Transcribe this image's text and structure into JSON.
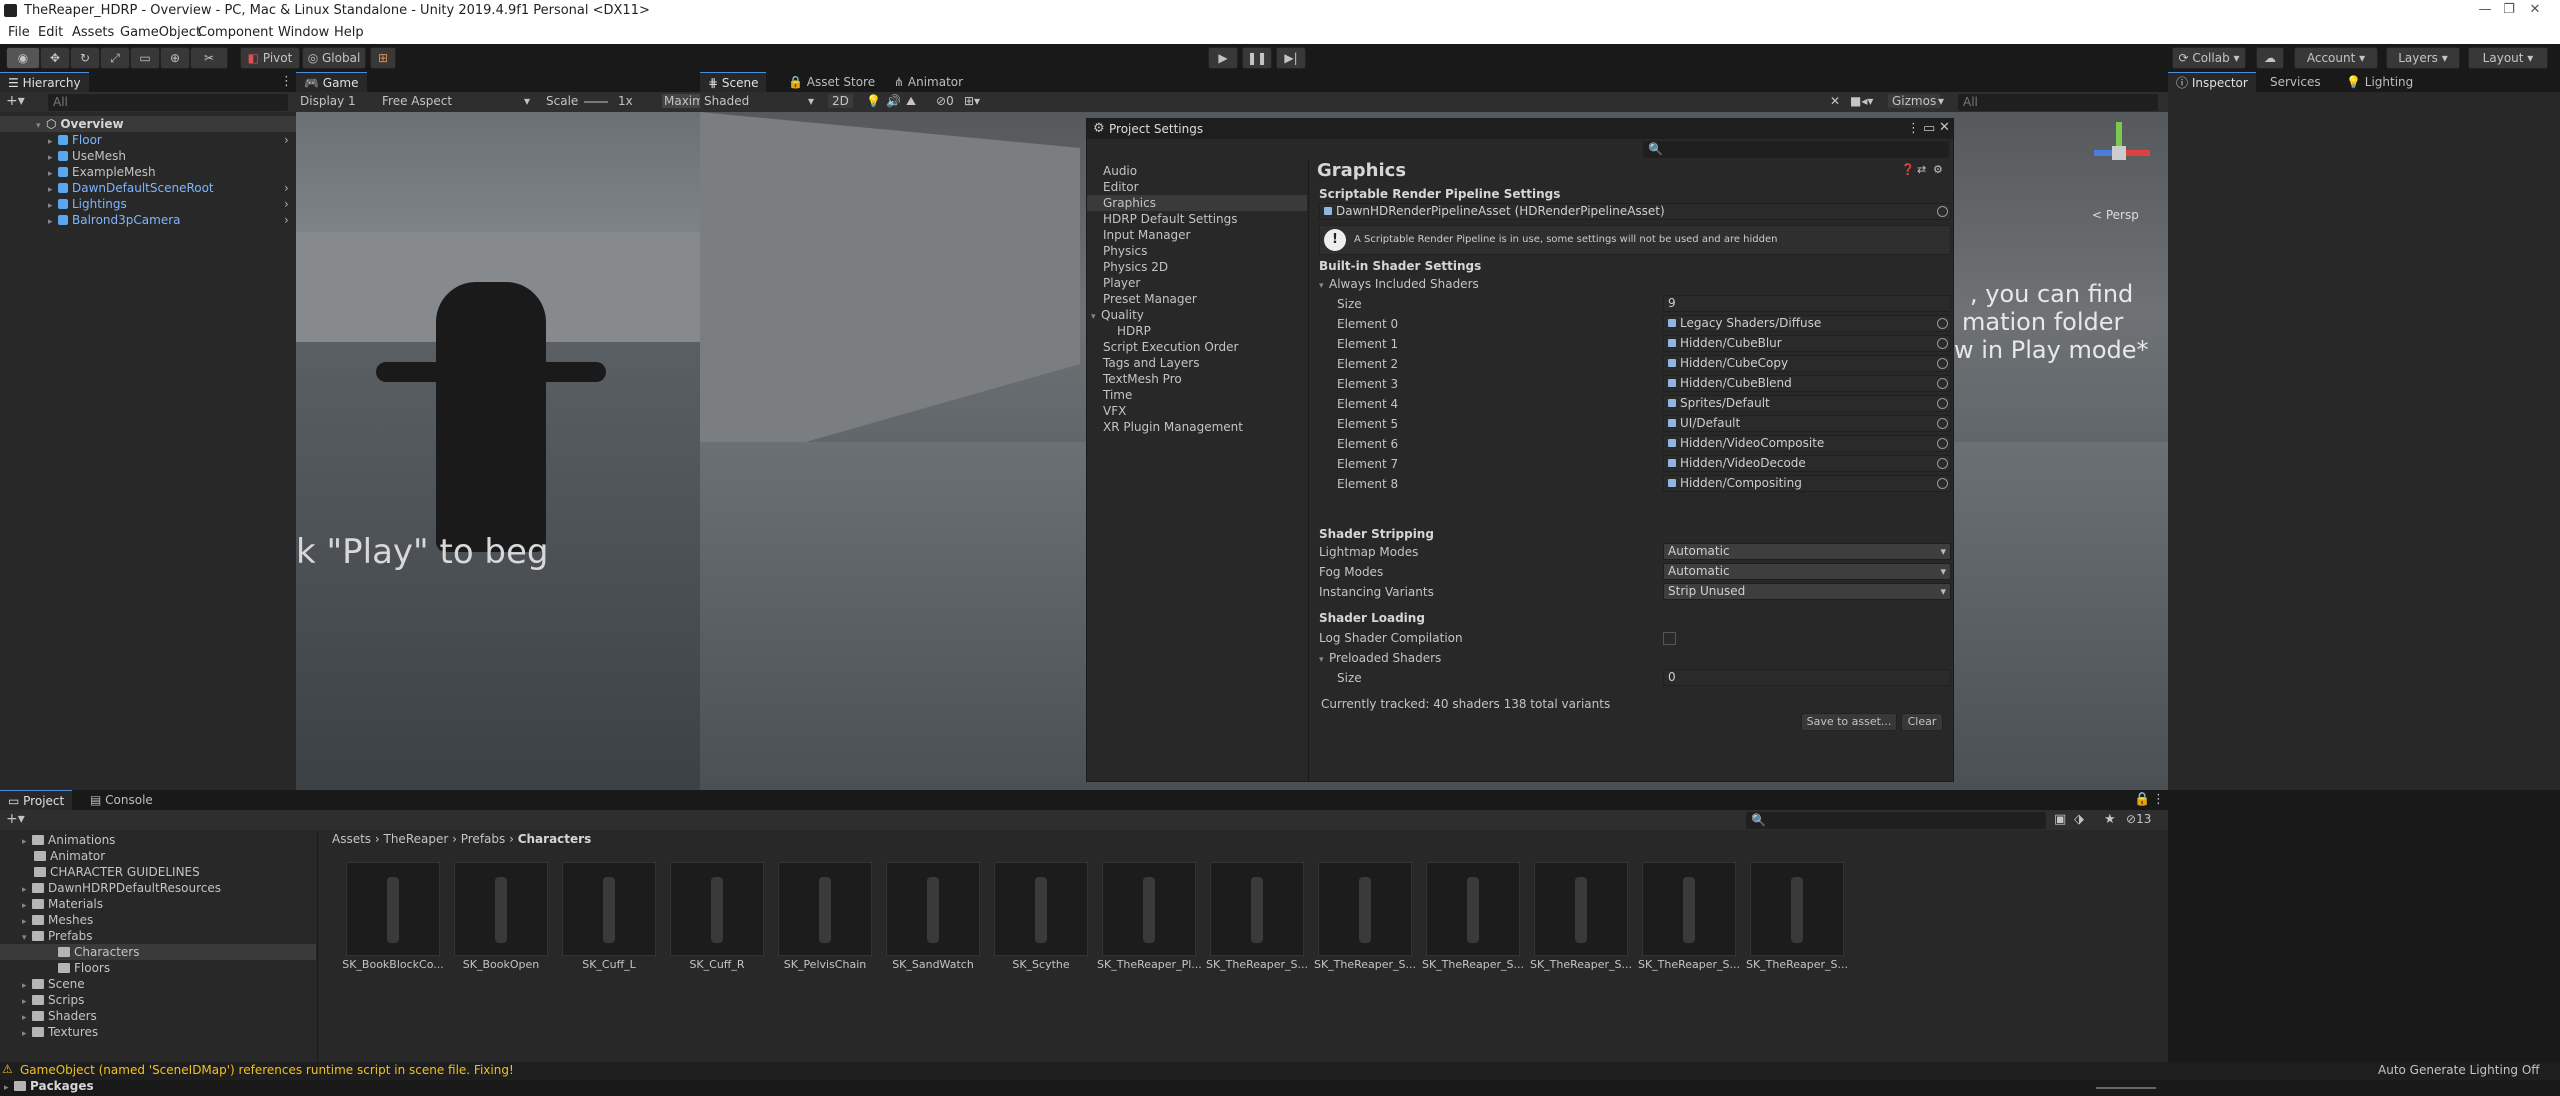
{
  "window": {
    "title": "TheReaper_HDRP - Overview - PC, Mac & Linux Standalone - Unity 2019.4.9f1 Personal <DX11>"
  },
  "menu": [
    "File",
    "Edit",
    "Assets",
    "GameObject",
    "Component",
    "Window",
    "Help"
  ],
  "toolbar": {
    "pivot": "Pivot",
    "global": "Global",
    "collab": "Collab",
    "account": "Account",
    "layers": "Layers",
    "layout": "Layout"
  },
  "hierarchy": {
    "tab": "Hierarchy",
    "search_placeholder": "All",
    "scene": "Overview",
    "items": [
      {
        "label": "Floor",
        "blue": true
      },
      {
        "label": "UseMesh",
        "blue": false
      },
      {
        "label": "ExampleMesh",
        "blue": false
      },
      {
        "label": "DawnDefaultSceneRoot",
        "blue": true
      },
      {
        "label": "Lightings",
        "blue": true
      },
      {
        "label": "Balrond3pCamera",
        "blue": true
      }
    ]
  },
  "game": {
    "tab": "Game",
    "display": "Display 1",
    "aspect": "Free Aspect",
    "scale_label": "Scale",
    "scale_value": "1x",
    "maximize": "Maxim",
    "overlay_text": "k \"Play\" to beg"
  },
  "scene": {
    "tabs": [
      "Scene",
      "Asset Store",
      "Animator"
    ],
    "shading": "Shaded",
    "mode2d": "2D",
    "fx_count": "0",
    "gizmos": "Gizmos",
    "search_placeholder": "All",
    "persp": "< Persp",
    "overlay_lines": [
      ", you can find",
      "mation folder",
      "w in Play mode*"
    ]
  },
  "inspector": {
    "tabs": [
      "Inspector",
      "Services",
      "Lighting"
    ]
  },
  "project_settings": {
    "title": "Project Settings",
    "nav": [
      "Audio",
      "Editor",
      "Graphics",
      "HDRP Default Settings",
      "Input Manager",
      "Physics",
      "Physics 2D",
      "Player",
      "Preset Manager",
      "Quality",
      "HDRP",
      "Script Execution Order",
      "Tags and Layers",
      "TextMesh Pro",
      "Time",
      "VFX",
      "XR Plugin Management"
    ],
    "selected": "Graphics",
    "heading": "Graphics",
    "srp_header": "Scriptable Render Pipeline Settings",
    "srp_asset": "DawnHDRenderPipelineAsset (HDRenderPipelineAsset)",
    "warning": "A Scriptable Render Pipeline is in use, some settings will not be used and are hidden",
    "builtin_header": "Built-in Shader Settings",
    "always_included": "Always Included Shaders",
    "size_label": "Size",
    "size_value": "9",
    "elements": [
      {
        "label": "Element 0",
        "value": "Legacy Shaders/Diffuse"
      },
      {
        "label": "Element 1",
        "value": "Hidden/CubeBlur"
      },
      {
        "label": "Element 2",
        "value": "Hidden/CubeCopy"
      },
      {
        "label": "Element 3",
        "value": "Hidden/CubeBlend"
      },
      {
        "label": "Element 4",
        "value": "Sprites/Default"
      },
      {
        "label": "Element 5",
        "value": "UI/Default"
      },
      {
        "label": "Element 6",
        "value": "Hidden/VideoComposite"
      },
      {
        "label": "Element 7",
        "value": "Hidden/VideoDecode"
      },
      {
        "label": "Element 8",
        "value": "Hidden/Compositing"
      }
    ],
    "stripping_header": "Shader Stripping",
    "lightmap_label": "Lightmap Modes",
    "lightmap_value": "Automatic",
    "fog_label": "Fog Modes",
    "fog_value": "Automatic",
    "instancing_label": "Instancing Variants",
    "instancing_value": "Strip Unused",
    "loading_header": "Shader Loading",
    "log_label": "Log Shader Compilation",
    "preloaded_label": "Preloaded Shaders",
    "preload_size_label": "Size",
    "preload_size_value": "0",
    "tracked": "Currently tracked: 40 shaders 138 total variants",
    "save_btn": "Save to asset...",
    "clear_btn": "Clear"
  },
  "project": {
    "tabs": [
      "Project",
      "Console"
    ],
    "tree": [
      {
        "label": "Animations",
        "indent": 1,
        "arrow": true
      },
      {
        "label": "Animator",
        "indent": 1,
        "arrow": false
      },
      {
        "label": "CHARACTER GUIDELINES",
        "indent": 1,
        "arrow": false
      },
      {
        "label": "DawnHDRPDefaultResources",
        "indent": 1,
        "arrow": true
      },
      {
        "label": "Materials",
        "indent": 1,
        "arrow": true
      },
      {
        "label": "Meshes",
        "indent": 1,
        "arrow": true
      },
      {
        "label": "Prefabs",
        "indent": 1,
        "arrow": true
      },
      {
        "label": "Characters",
        "indent": 2,
        "arrow": false
      },
      {
        "label": "Floors",
        "indent": 2,
        "arrow": false
      },
      {
        "label": "Scene",
        "indent": 1,
        "arrow": true
      },
      {
        "label": "Scrips",
        "indent": 1,
        "arrow": true
      },
      {
        "label": "Shaders",
        "indent": 1,
        "arrow": true
      },
      {
        "label": "Textures",
        "indent": 1,
        "arrow": true
      }
    ],
    "packages": "Packages",
    "breadcrumb": [
      "Assets",
      "TheReaper",
      "Prefabs",
      "Characters"
    ],
    "hidden_count": "13",
    "assets": [
      "SK_BookBlockCo...",
      "SK_BookOpen",
      "SK_Cuff_L",
      "SK_Cuff_R",
      "SK_PelvisChain",
      "SK_SandWatch",
      "SK_Scythe",
      "SK_TheReaper_Pl...",
      "SK_TheReaper_S...",
      "SK_TheReaper_S...",
      "SK_TheReaper_S...",
      "SK_TheReaper_S...",
      "SK_TheReaper_S...",
      "SK_TheReaper_S..."
    ]
  },
  "status": {
    "message": "GameObject (named 'SceneIDMap') references runtime script in scene file. Fixing!",
    "right": "Auto Generate Lighting Off"
  }
}
